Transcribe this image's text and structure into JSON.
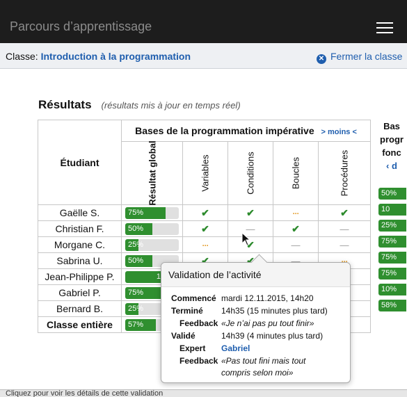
{
  "app": {
    "title": "Parcours d’apprentissage"
  },
  "classbar": {
    "label_prefix": "Classe:",
    "class_name": "Introduction à la programmation",
    "close_label": "Fermer la classe"
  },
  "results": {
    "heading": "Résultats",
    "subtitle": "(résultats mis à jour en temps réel)"
  },
  "table": {
    "student_header": "Étudiant",
    "group1": {
      "title": "Bases de la programmation impérative",
      "toggle": "> moins <"
    },
    "columns": [
      "Résultat global",
      "Variables",
      "Conditions",
      "Boucles",
      "Procédures"
    ],
    "group2_partial": [
      "Bas",
      "progr",
      "fonc",
      "‹ d"
    ],
    "rows": [
      {
        "name": "Gaëlle S.",
        "global": 75,
        "marks": [
          "check",
          "check",
          "dots",
          "check"
        ],
        "right": "50%"
      },
      {
        "name": "Christian F.",
        "global": 50,
        "marks": [
          "check",
          "dash",
          "check",
          "dash"
        ],
        "right": "10"
      },
      {
        "name": "Morgane C.",
        "global": 25,
        "marks": [
          "dots",
          "check",
          "dash",
          "dash"
        ],
        "right": "25%"
      },
      {
        "name": "Sabrina U.",
        "global": 50,
        "marks": [
          "check",
          "check",
          "dash",
          "dots"
        ],
        "right": "75%"
      },
      {
        "name": "Jean-Philippe P.",
        "global": 100,
        "marks": [
          "",
          "",
          "",
          "check"
        ],
        "right": "75%"
      },
      {
        "name": "Gabriel P.",
        "global": 75,
        "marks": [
          "",
          "",
          "",
          "dots"
        ],
        "right": "75%"
      },
      {
        "name": "Bernard B.",
        "global": 25,
        "marks": [
          "",
          "",
          "",
          "dots"
        ],
        "right": "10%"
      }
    ],
    "total": {
      "name": "Classe entière",
      "global": 57,
      "right": "58%"
    }
  },
  "popup": {
    "title": "Validation de l’activité",
    "commence_label": "Commencé",
    "commence_value": "mardi 12.11.2015, 14h20",
    "termine_label": "Terminé",
    "termine_value": "14h35 (15 minutes plus tard)",
    "feedback1_label": "Feedback",
    "feedback1_value": "«Je n’ai pas pu tout finir»",
    "valide_label": "Validé",
    "valide_value": "14h39 (4 minutes plus tard)",
    "expert_label": "Expert",
    "expert_value": "Gabriel",
    "feedback2_label": "Feedback",
    "feedback2_line1": "«Pas tout fini mais tout",
    "feedback2_line2": "compris selon moi»"
  },
  "status": {
    "text": "Cliquez pour voir les détails de cette validation"
  },
  "colors": {
    "green": "#2f8f2f",
    "blue": "#1f5eae",
    "orange": "#e6a43a"
  },
  "icons": {
    "menu": "hamburger-icon",
    "close": "close-circle-icon",
    "check": "check-icon"
  }
}
